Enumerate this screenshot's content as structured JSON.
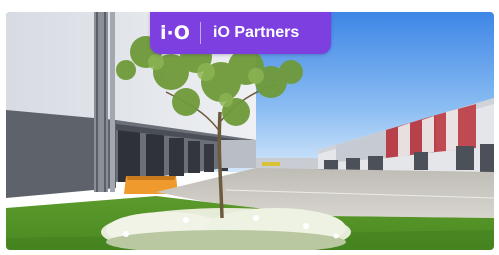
{
  "brand": {
    "logo_text": "i·O",
    "name": "iO Partners",
    "badge_color": "#7d3fe0"
  },
  "scene": {
    "icon": "warehouse-photo"
  }
}
